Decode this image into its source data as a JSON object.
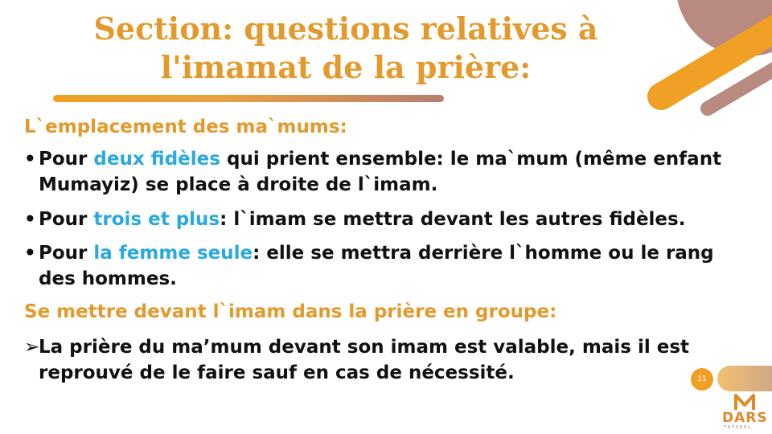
{
  "title": {
    "line1": "Section: questions relatives à",
    "line2": "l'imamat de la prière:"
  },
  "section1": {
    "heading": "L`emplacement des ma`mums:",
    "bullets": [
      {
        "marker": "•",
        "pre": "Pour ",
        "accent": "deux fidèles",
        "post": " qui prient ensemble: le ma`mum (même enfant Mumayiz) se place à droite de l`imam."
      },
      {
        "marker": "•",
        "pre": "Pour ",
        "accent": "trois et plus",
        "post": ": l`imam se mettra devant les autres fidèles."
      },
      {
        "marker": "•",
        "pre": "Pour ",
        "accent": "la femme seule",
        "post": ": elle se mettra derrière l`homme ou le rang des hommes."
      }
    ]
  },
  "section2": {
    "heading": "Se mettre devant l`imam dans la prière en groupe:",
    "bullet": {
      "marker": "➢",
      "text": " La prière du ma’mum devant son imam est valable, mais il est reprouvé de le faire sauf en cas de nécessité."
    }
  },
  "page_number": "11",
  "logo": {
    "name": "DARS",
    "subtitle": "TAFSEEL"
  },
  "colors": {
    "title": "#e39a2d",
    "accent": "#2aa9de",
    "orange": "#f0a024",
    "mauve": "#b88a80"
  }
}
